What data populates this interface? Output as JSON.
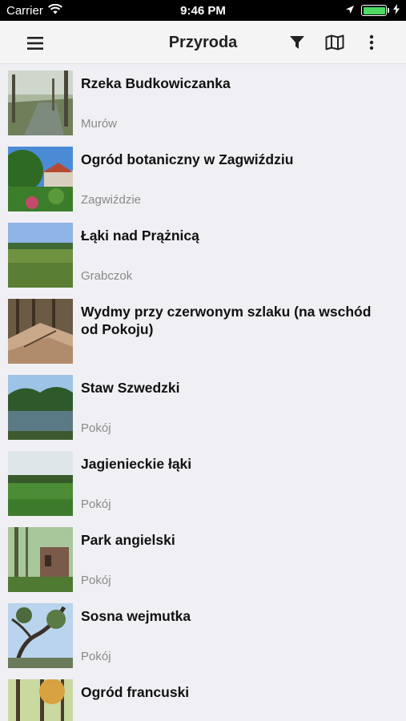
{
  "status": {
    "carrier": "Carrier",
    "time": "9:46 PM"
  },
  "nav": {
    "title": "Przyroda"
  },
  "items": [
    {
      "title": "Rzeka Budkowiczanka",
      "location": "Murów"
    },
    {
      "title": "Ogród botaniczny w Zagwiździu",
      "location": "Zagwiździe"
    },
    {
      "title": "Łąki nad Prążnicą",
      "location": "Grabczok"
    },
    {
      "title": "Wydmy przy czerwonym szlaku (na wschód od Pokoju)",
      "location": ""
    },
    {
      "title": "Staw Szwedzki",
      "location": "Pokój"
    },
    {
      "title": "Jagienieckie łąki",
      "location": "Pokój"
    },
    {
      "title": "Park angielski",
      "location": "Pokój"
    },
    {
      "title": "Sosna wejmutka",
      "location": "Pokój"
    },
    {
      "title": "Ogród francuski",
      "location": ""
    }
  ],
  "colors": {
    "background": "#efeff4",
    "battery": "#4cd964",
    "location_text": "#8a8a8a"
  }
}
